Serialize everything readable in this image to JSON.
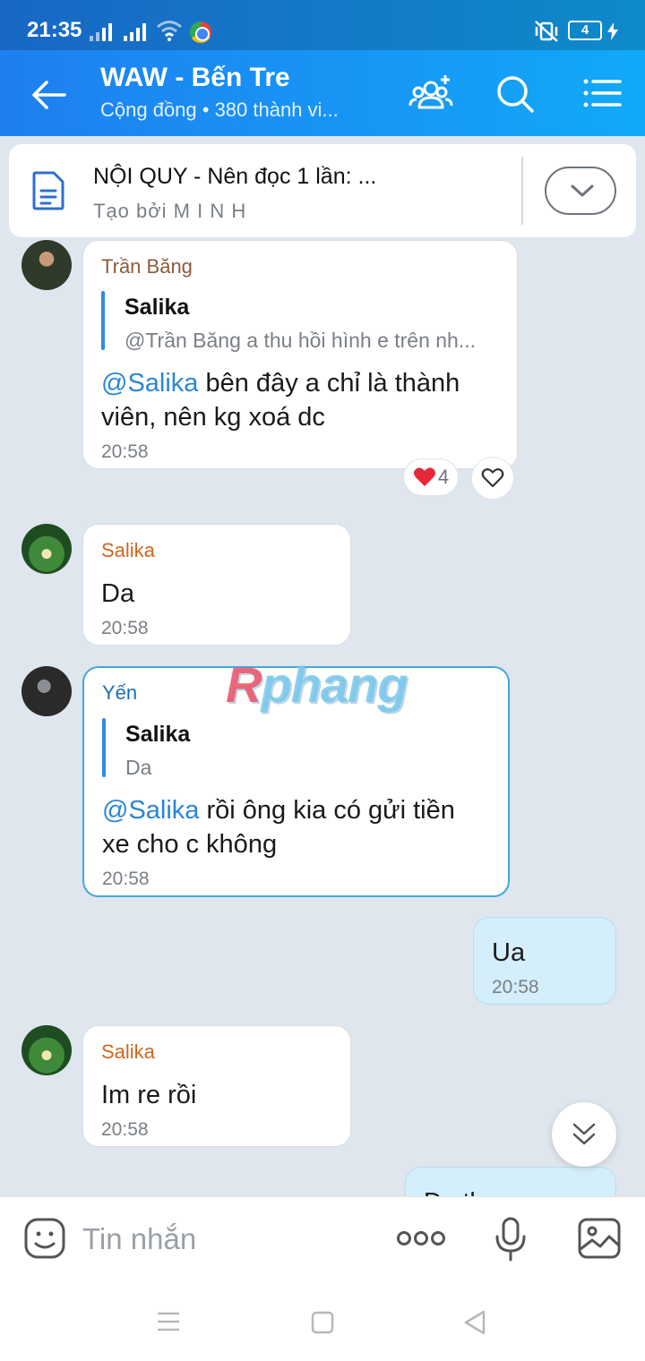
{
  "status": {
    "time": "21:35",
    "battery": "4"
  },
  "header": {
    "title": "WAW - Bến Tre",
    "subtitle": "Cộng đồng • 380 thành vi..."
  },
  "pinned": {
    "title": "NỘI QUY - Nên đọc 1 lần: ...",
    "subtitle": "Tạo bởi M I N H"
  },
  "messages": [
    {
      "sender": "Trần Băng",
      "quote_name": "Salika",
      "quote_text": "@Trần Băng a thu hồi hình e trên nh...",
      "mention": "@Salika",
      "text_line1": " bên đây a chỉ là thành",
      "text_line2": "viên, nên kg xoá dc",
      "time": "20:58",
      "reaction_count": "4"
    },
    {
      "sender": "Salika",
      "text": "Da",
      "time": "20:58"
    },
    {
      "sender": "Yến",
      "quote_name": "Salika",
      "quote_text": "Da",
      "mention": "@Salika",
      "text_line1": " rồi ông kia có gửi tiền",
      "text_line2": "xe cho c không",
      "time": "20:58"
    },
    {
      "sender": "me",
      "text": "Ua",
      "time": "20:58"
    },
    {
      "sender": "Salika",
      "text": "Im re rồi",
      "time": "20:58"
    },
    {
      "sender": "me",
      "text": "Đạ th"
    }
  ],
  "watermark": {
    "first": "R",
    "rest": "phang"
  },
  "input": {
    "placeholder": "Tin nhắn"
  },
  "colors": {
    "header_start": "#1e7ff0",
    "header_end": "#11a9f7",
    "mention": "#2a86d6",
    "self_bubble": "#d4eefc",
    "chat_bg": "#dfe6ee"
  }
}
